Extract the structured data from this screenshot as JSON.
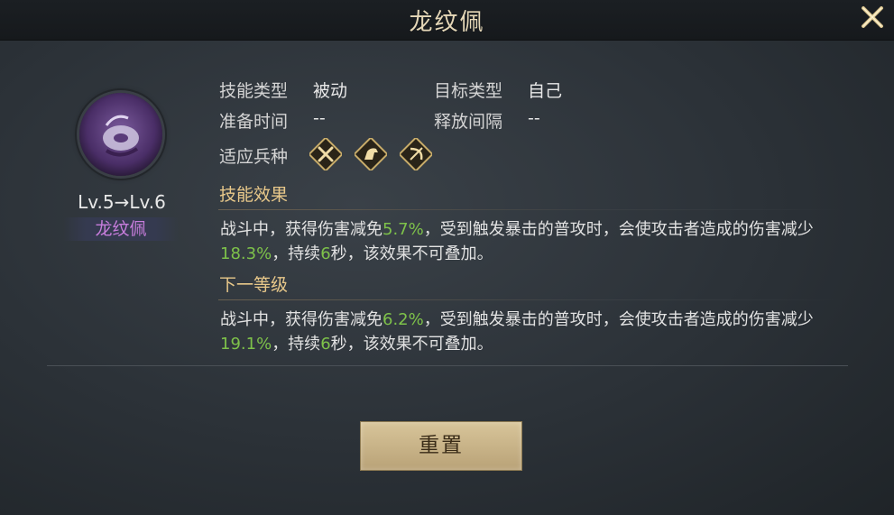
{
  "window": {
    "title": "龙纹佩"
  },
  "item": {
    "level_text": "Lv.5→Lv.6",
    "name": "龙纹佩"
  },
  "stats": {
    "skill_type_label": "技能类型",
    "skill_type_value": "被动",
    "target_type_label": "目标类型",
    "target_type_value": "自己",
    "prep_time_label": "准备时间",
    "prep_time_value": "--",
    "interval_label": "释放间隔",
    "interval_value": "--",
    "troops_label": "适应兵种",
    "troops_icons": [
      "crossed-swords-icon",
      "horse-icon",
      "bow-icon"
    ]
  },
  "effect": {
    "heading": "技能效果",
    "p1": "战斗中，获得伤害减免",
    "v1": "5.7%",
    "p2": "，受到触发暴击的普攻时，会使攻击者造成的伤害减少",
    "v2": "18.3%",
    "p3": "，持续",
    "v3": "6",
    "p4": "秒，该效果不可叠加。"
  },
  "next": {
    "heading": "下一等级",
    "p1": "战斗中，获得伤害减免",
    "v1": "6.2%",
    "p2": "，受到触发暴击的普攻时，会使攻击者造成的伤害减少",
    "v2": "19.1%",
    "p3": "，持续",
    "v3": "6",
    "p4": "秒，该效果不可叠加。"
  },
  "actions": {
    "reset_label": "重置"
  },
  "colors": {
    "highlight": "#7ec24a",
    "section": "#e8c88a",
    "name": "#c77ddc"
  }
}
